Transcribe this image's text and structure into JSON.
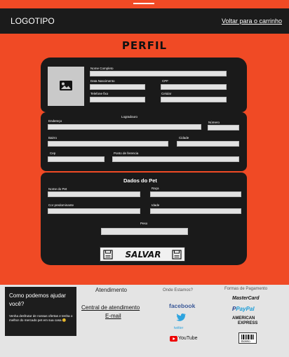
{
  "header": {
    "logo": "LOGOTIPO",
    "back_link": "Voltar para o carrinho"
  },
  "page_title": "PERFIL",
  "personal": {
    "nome_label": "Nome Completo",
    "nascimento_label": "Data Nascimento",
    "cpf_label": "CPF",
    "telefone_label": "Telefone fixo",
    "celular_label": "Celular"
  },
  "address": {
    "logradouro_label": "Logradouro",
    "endereco_label": "Endereço",
    "numero_label": "Número",
    "bairro_label": "Bairro",
    "cidade_label": "Cidade",
    "cep_label": "Cep",
    "referencia_label": "Ponto de ferencia"
  },
  "pet": {
    "title": "Dados  do Pet",
    "nome_label": "Nome do Pet",
    "raca_label": "Raça",
    "cor_label": "Cor predominante",
    "idade_label": "Idade",
    "peso_label": "Peso"
  },
  "save_label": "SALVAR",
  "footer": {
    "help_title": "Como podemos ajudar você?",
    "help_text": "Venha desfrutar de nossas ofertas e tenha o melhor do mercado pet em sua casa 😊",
    "atendimento_title": "Atendimento",
    "atendimento_link": "Central de atendimento",
    "email_link": "E-mail",
    "onde_title": "Onde Estamos?",
    "facebook": "facebook",
    "twitter": "twitter",
    "youtube": "YouTube",
    "pagamento_title": "Formas de Pagamento",
    "mastercard": "MasterCard",
    "paypal": "PayPal",
    "amex_1": "AMERICAN",
    "amex_2": "EXPRESS",
    "boleto": "Boleto"
  }
}
